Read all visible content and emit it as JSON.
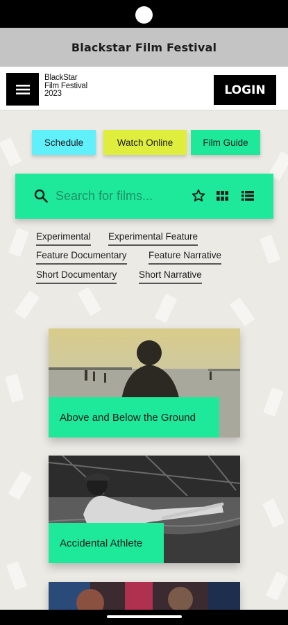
{
  "window": {
    "title": "Blackstar Film Festival"
  },
  "header": {
    "logo_lines": [
      "BlackStar",
      "Film Festival",
      "2023"
    ],
    "login_label": "LOGIN"
  },
  "nav_pills": [
    {
      "label": "Schedule",
      "color": "#5ff0fb"
    },
    {
      "label": "Watch Online",
      "color": "#dfee3c"
    },
    {
      "label": "Film Guide",
      "color": "#1ee99a"
    }
  ],
  "search": {
    "placeholder": "Search for films..."
  },
  "filters": [
    "Experimental",
    "Experimental Feature",
    "Feature Documentary",
    "Feature Narrative",
    "Short Documentary",
    "Short Narrative"
  ],
  "films": [
    {
      "title": "Above and Below the Ground"
    },
    {
      "title": "Accidental Athlete"
    },
    {
      "title": ""
    }
  ],
  "colors": {
    "accent": "#1ee99a",
    "background": "#eceae5",
    "dark": "#000000"
  },
  "icons": [
    "menu-icon",
    "search-icon",
    "star-icon",
    "grid-view-icon",
    "list-view-icon"
  ]
}
